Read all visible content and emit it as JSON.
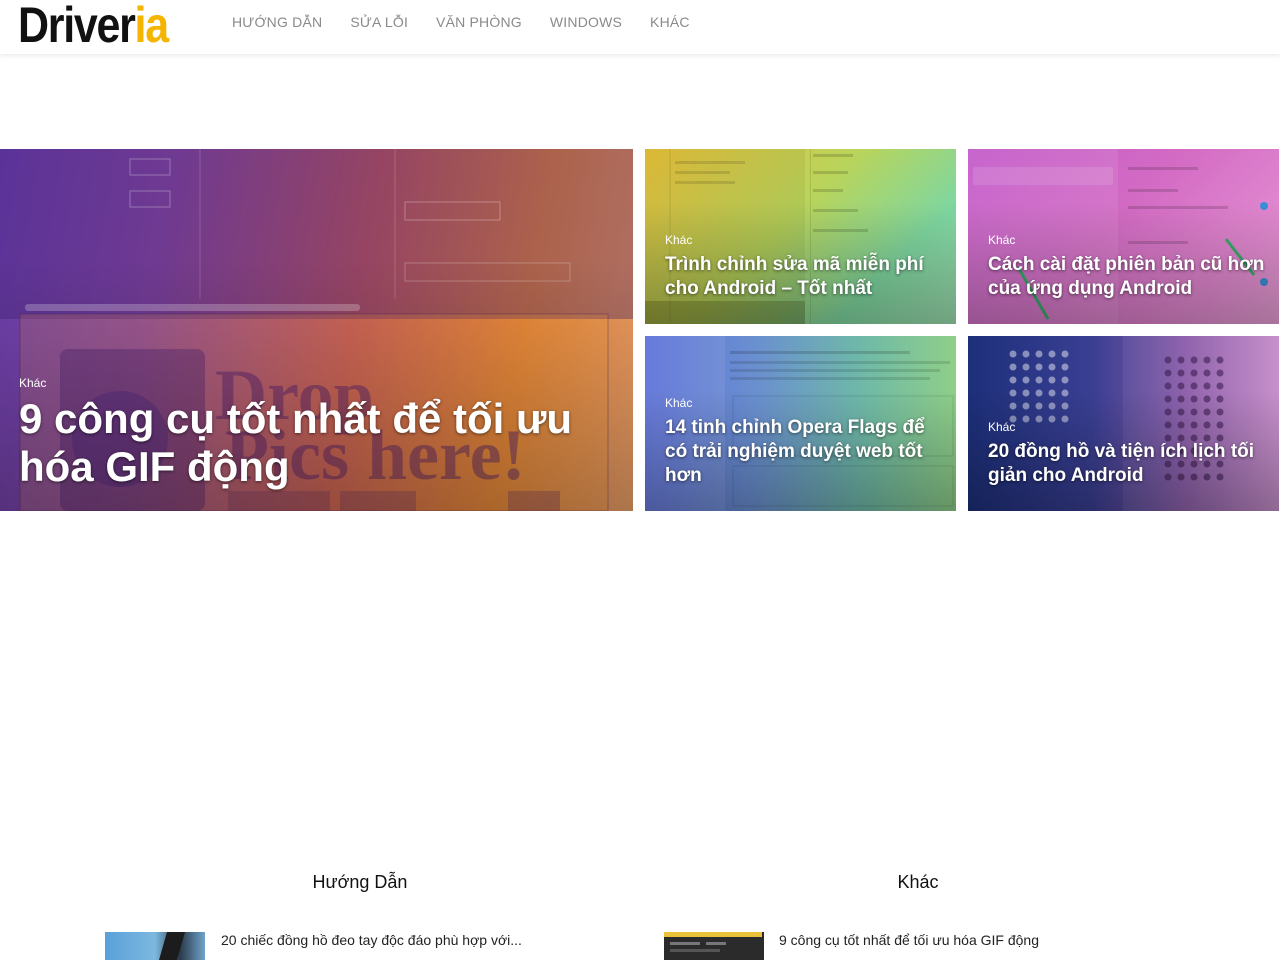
{
  "header": {
    "logo_part1": "Driver",
    "logo_part2": "ia",
    "nav": [
      "HƯỚNG DẪN",
      "SỬA LỖI",
      "VĂN PHÒNG",
      "WINDOWS",
      "KHÁC"
    ]
  },
  "featured": {
    "big": {
      "category": "Khác",
      "title": "9 công cụ tốt nhất để tối ưu hóa GIF động"
    },
    "tiles": [
      {
        "category": "Khác",
        "title": "Trình chỉnh sửa mã miễn phí cho Android – Tốt nhất"
      },
      {
        "category": "Khác",
        "title": "Cách cài đặt phiên bản cũ hơn của ứng dụng Android"
      },
      {
        "category": "Khác",
        "title": "14 tinh chỉnh Opera Flags để có trải nghiệm duyệt web tốt hơn"
      },
      {
        "category": "Khác",
        "title": "20 đồng hồ và tiện ích lịch tối giản cho Android"
      }
    ]
  },
  "sections": [
    {
      "heading": "Hướng Dẫn",
      "first_item": "20 chiếc đồng hồ đeo tay độc đáo phù hợp với..."
    },
    {
      "heading": "Khác",
      "first_item": "9 công cụ tốt nhất để tối ưu hóa GIF động"
    }
  ],
  "colors": {
    "brand_yellow": "#f4b400",
    "nav_text": "#8a8a8a"
  }
}
